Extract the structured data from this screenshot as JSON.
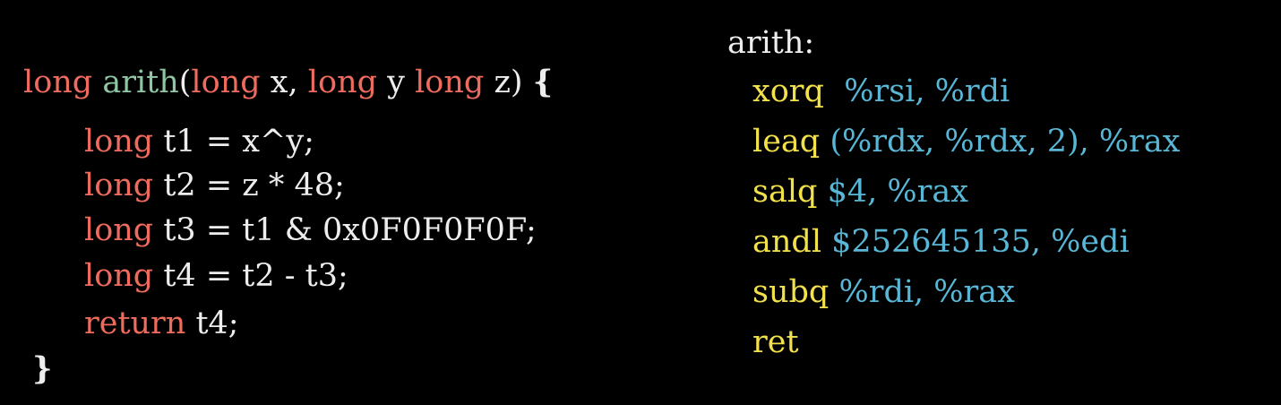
{
  "colors": {
    "keyword": "#ee6b5e",
    "function": "#8fc7a4",
    "text": "#ededed",
    "mnemonic": "#f2e14a",
    "operand": "#58b7d6",
    "background": "#000000"
  },
  "c_code": {
    "signature": {
      "kw_long_1": "long",
      "fn_name": "arith",
      "open_paren": "(",
      "kw_long_2": "long",
      "param_x": "x,",
      "kw_long_3": "long",
      "param_y": "y",
      "kw_long_4": "long",
      "param_z": "z)",
      "open_brace": "{"
    },
    "lines": [
      {
        "keyword": "long",
        "code": "t1 = x^y;"
      },
      {
        "keyword": "long",
        "code": "t2 = z * 48;"
      },
      {
        "keyword": "long",
        "code": "t3 = t1 & 0x0F0F0F0F;"
      },
      {
        "keyword": "long",
        "code": "t4 = t2 - t3;"
      },
      {
        "keyword": "return",
        "code": "t4;"
      }
    ],
    "close_brace": "}"
  },
  "asm_code": {
    "label": "arith:",
    "instructions": [
      {
        "mnemonic": "xorq",
        "operands": "%rsi, %rdi"
      },
      {
        "mnemonic": "leaq",
        "operands": "(%rdx, %rdx, 2), %rax"
      },
      {
        "mnemonic": "salq",
        "operands": "$4, %rax"
      },
      {
        "mnemonic": "andl",
        "operands": "$252645135, %edi"
      },
      {
        "mnemonic": "subq",
        "operands": "%rdi, %rax"
      },
      {
        "mnemonic": "ret",
        "operands": ""
      }
    ]
  }
}
